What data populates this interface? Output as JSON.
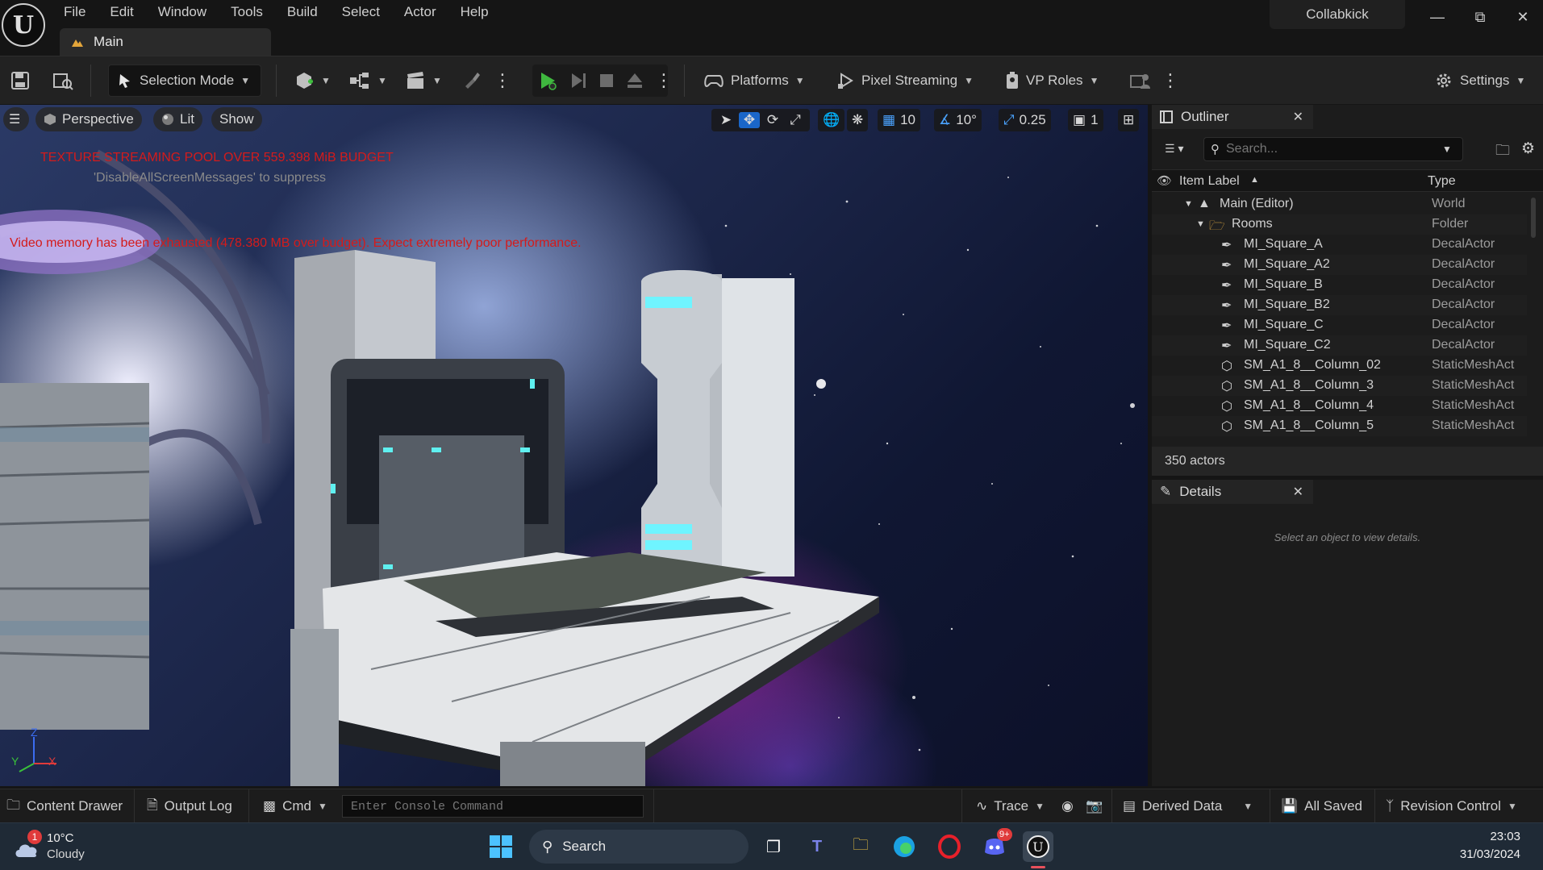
{
  "app": {
    "menu": [
      "File",
      "Edit",
      "Window",
      "Tools",
      "Build",
      "Select",
      "Actor",
      "Help"
    ],
    "tab_title": "Main",
    "project_name": "Collabkick"
  },
  "toolbar": {
    "selection_mode": "Selection Mode",
    "platforms": "Platforms",
    "pixel_streaming": "Pixel Streaming",
    "vp_roles": "VP Roles",
    "settings": "Settings"
  },
  "viewport": {
    "perspective": "Perspective",
    "lit": "Lit",
    "show": "Show",
    "grid_snap": "10",
    "rotation_snap": "10°",
    "scale_snap": "0.25",
    "camera_speed": "1",
    "warning_texture": "TEXTURE STREAMING POOL OVER 559.398 MiB BUDGET",
    "warning_suppress": "'DisableAllScreenMessages' to suppress",
    "warning_video": "Video memory has been exhausted (478.380 MB over budget). Expect extremely poor performance.",
    "axis": {
      "z": "Z",
      "x": "X",
      "y": "Y"
    }
  },
  "outliner": {
    "title": "Outliner",
    "search_placeholder": "Search...",
    "col_label": "Item Label",
    "col_type": "Type",
    "rows": [
      {
        "label": "Main (Editor)",
        "type": "World",
        "icon": "world-icon"
      },
      {
        "label": "Rooms",
        "type": "Folder",
        "icon": "folder-icon"
      },
      {
        "label": "MI_Square_A",
        "type": "DecalActor",
        "icon": "decal-icon"
      },
      {
        "label": "MI_Square_A2",
        "type": "DecalActor",
        "icon": "decal-icon"
      },
      {
        "label": "MI_Square_B",
        "type": "DecalActor",
        "icon": "decal-icon"
      },
      {
        "label": "MI_Square_B2",
        "type": "DecalActor",
        "icon": "decal-icon"
      },
      {
        "label": "MI_Square_C",
        "type": "DecalActor",
        "icon": "decal-icon"
      },
      {
        "label": "MI_Square_C2",
        "type": "DecalActor",
        "icon": "decal-icon"
      },
      {
        "label": "SM_A1_8__Column_02",
        "type": "StaticMeshAct",
        "icon": "mesh-icon"
      },
      {
        "label": "SM_A1_8__Column_3",
        "type": "StaticMeshAct",
        "icon": "mesh-icon"
      },
      {
        "label": "SM_A1_8__Column_4",
        "type": "StaticMeshAct",
        "icon": "mesh-icon"
      },
      {
        "label": "SM_A1_8__Column_5",
        "type": "StaticMeshAct",
        "icon": "mesh-icon"
      }
    ],
    "actor_count": "350 actors"
  },
  "details": {
    "title": "Details",
    "empty_text": "Select an object to view details."
  },
  "statusbar": {
    "content_drawer": "Content Drawer",
    "output_log": "Output Log",
    "cmd": "Cmd",
    "console_placeholder": "Enter Console Command",
    "trace": "Trace",
    "derived_data": "Derived Data",
    "all_saved": "All Saved",
    "revision_control": "Revision Control"
  },
  "taskbar": {
    "weather_badge": "1",
    "temperature": "10°C",
    "weather": "Cloudy",
    "search": "Search",
    "discord_badge": "9+",
    "time": "23:03",
    "date": "31/03/2024"
  }
}
